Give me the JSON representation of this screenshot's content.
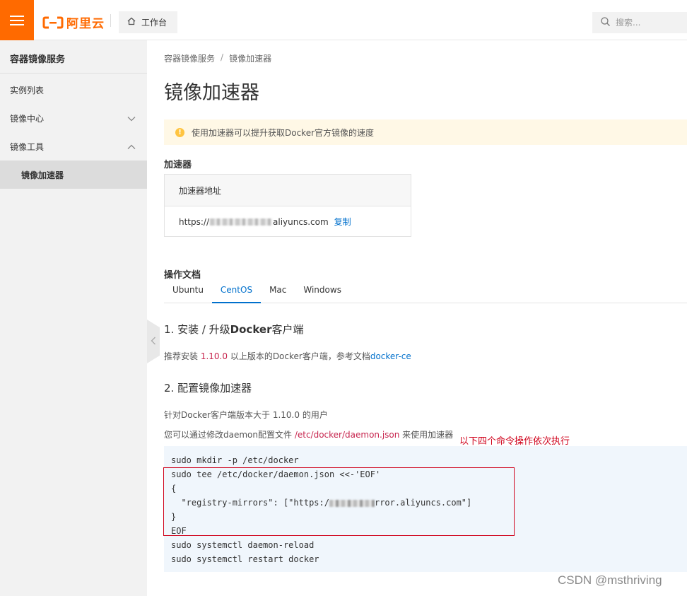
{
  "header": {
    "brand": "阿里云",
    "workbench_label": "工作台",
    "search_placeholder": "搜索...",
    "brand_color": "#ff6a00"
  },
  "sidebar": {
    "title": "容器镜像服务",
    "items": [
      {
        "label": "实例列表",
        "icon": "",
        "expanded": null
      },
      {
        "label": "镜像中心",
        "icon": "chevron-down-icon",
        "expanded": false
      },
      {
        "label": "镜像工具",
        "icon": "chevron-up-icon",
        "expanded": true
      },
      {
        "label": "镜像加速器",
        "icon": "",
        "sub": true,
        "active": true
      }
    ]
  },
  "main": {
    "breadcrumb": [
      "容器镜像服务",
      "/",
      "镜像加速器"
    ],
    "title": "镜像加速器",
    "notice": "使用加速器可以提升获取Docker官方镜像的速度",
    "accelerator_section": "加速器",
    "accelerator_table": {
      "header": "加速器地址",
      "url_prefix": "https://",
      "url_suffix": "aliyuncs.com",
      "copy_label": "复制"
    },
    "docs_section": "操作文档",
    "tabs": [
      {
        "label": "Ubuntu",
        "active": false
      },
      {
        "label": "CentOS",
        "active": true
      },
      {
        "label": "Mac",
        "active": false
      },
      {
        "label": "Windows",
        "active": false
      }
    ],
    "step1": {
      "title_prefix": "1. 安装 / 升级",
      "title_bold": "Docker",
      "title_suffix": "客户端",
      "text_prefix": "推荐安装 ",
      "version": "1.10.0",
      "text_mid": " 以上版本的Docker客户端，参考文档",
      "doc_link": "docker-ce"
    },
    "step2": {
      "title": "2. 配置镜像加速器",
      "line1": "针对Docker客户端版本大于 1.10.0 的用户",
      "line2_prefix": "您可以通过修改daemon配置文件 ",
      "line2_path": "/etc/docker/daemon.json",
      "line2_suffix": " 来使用加速器"
    },
    "annotation": "以下四个命令操作依次执行",
    "code": {
      "l1": "sudo mkdir -p /etc/docker",
      "l2": "sudo tee /etc/docker/daemon.json <<-'EOF'",
      "l3": "{",
      "l4_prefix": "  \"registry-mirrors\": [\"https:/",
      "l4_suffix": "rror.aliyuncs.com\"]",
      "l5": "}",
      "l6": "EOF",
      "l7": "sudo systemctl daemon-reload",
      "l8": "sudo systemctl restart docker"
    }
  },
  "watermark": "CSDN @msthriving"
}
